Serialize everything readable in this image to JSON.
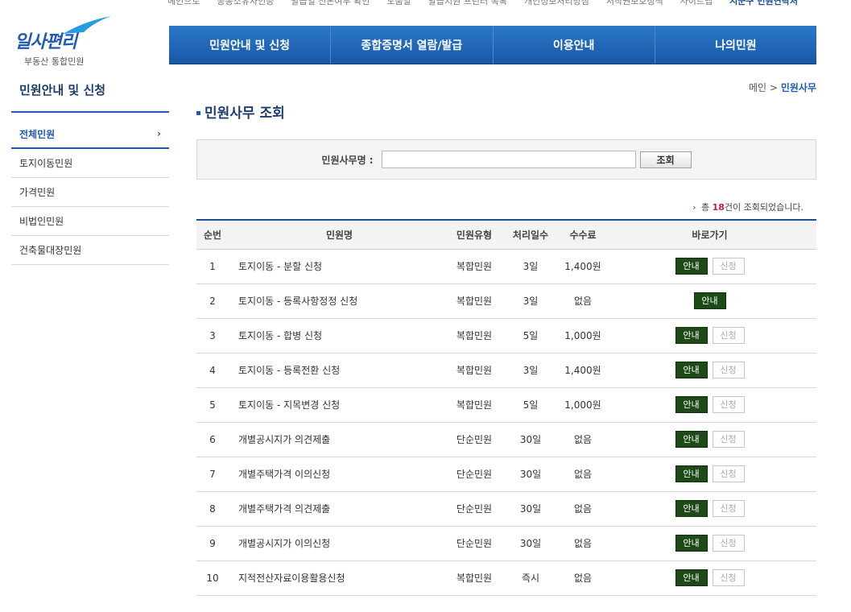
{
  "util_links": [
    "메인으로",
    "공동소유자인증",
    "발급일 진본여부 확인",
    "도움말",
    "발급지원 프린터 목록",
    "개인정보처리방침",
    "저작권보호정책",
    "사이트맵",
    "시군구 민원연락처"
  ],
  "logo": {
    "title": "일사편리",
    "subtitle": "부동산 통합민원"
  },
  "gnb": [
    "민원안내 및 신청",
    "종합증명서 열람/발급",
    "이용안내",
    "나의민원"
  ],
  "sidebar": {
    "title": "민원안내 및 신청",
    "items": [
      {
        "label": "전체민원",
        "active": true
      },
      {
        "label": "토지이동민원"
      },
      {
        "label": "가격민원"
      },
      {
        "label": "비법인민원"
      },
      {
        "label": "건축물대장민원"
      }
    ]
  },
  "breadcrumb": {
    "home": "메인",
    "sep": ">",
    "current": "민원사무"
  },
  "page_title": "민원사무 조회",
  "search": {
    "label": "민원사무명 :",
    "value": "",
    "placeholder": "",
    "button": "조회"
  },
  "result": {
    "prefix": "총",
    "count": "18",
    "suffix": "건이 조회되었습니다."
  },
  "table": {
    "headers": [
      "순번",
      "민원명",
      "민원유형",
      "처리일수",
      "수수료",
      "바로가기"
    ],
    "guide_label": "안내",
    "apply_label": "신청",
    "rows": [
      {
        "no": "1",
        "name": "토지이동 - 분할 신청",
        "type": "복합민원",
        "days": "3일",
        "fee": "1,400원",
        "apply": true
      },
      {
        "no": "2",
        "name": "토지이동 - 등록사항정정 신청",
        "type": "복합민원",
        "days": "3일",
        "fee": "없음",
        "apply": false
      },
      {
        "no": "3",
        "name": "토지이동 - 합병 신청",
        "type": "복합민원",
        "days": "5일",
        "fee": "1,000원",
        "apply": true
      },
      {
        "no": "4",
        "name": "토지이동 - 등록전환 신청",
        "type": "복합민원",
        "days": "3일",
        "fee": "1,400원",
        "apply": true
      },
      {
        "no": "5",
        "name": "토지이동 - 지목변경 신청",
        "type": "복합민원",
        "days": "5일",
        "fee": "1,000원",
        "apply": true
      },
      {
        "no": "6",
        "name": "개별공시지가 의견제출",
        "type": "단순민원",
        "days": "30일",
        "fee": "없음",
        "apply": true
      },
      {
        "no": "7",
        "name": "개별주택가격 이의신청",
        "type": "단순민원",
        "days": "30일",
        "fee": "없음",
        "apply": true
      },
      {
        "no": "8",
        "name": "개별주택가격 의견제출",
        "type": "단순민원",
        "days": "30일",
        "fee": "없음",
        "apply": true
      },
      {
        "no": "9",
        "name": "개별공시지가 이의신청",
        "type": "단순민원",
        "days": "30일",
        "fee": "없음",
        "apply": true
      },
      {
        "no": "10",
        "name": "지적전산자료이용활용신청",
        "type": "복합민원",
        "days": "즉시",
        "fee": "없음",
        "apply": true
      }
    ]
  }
}
